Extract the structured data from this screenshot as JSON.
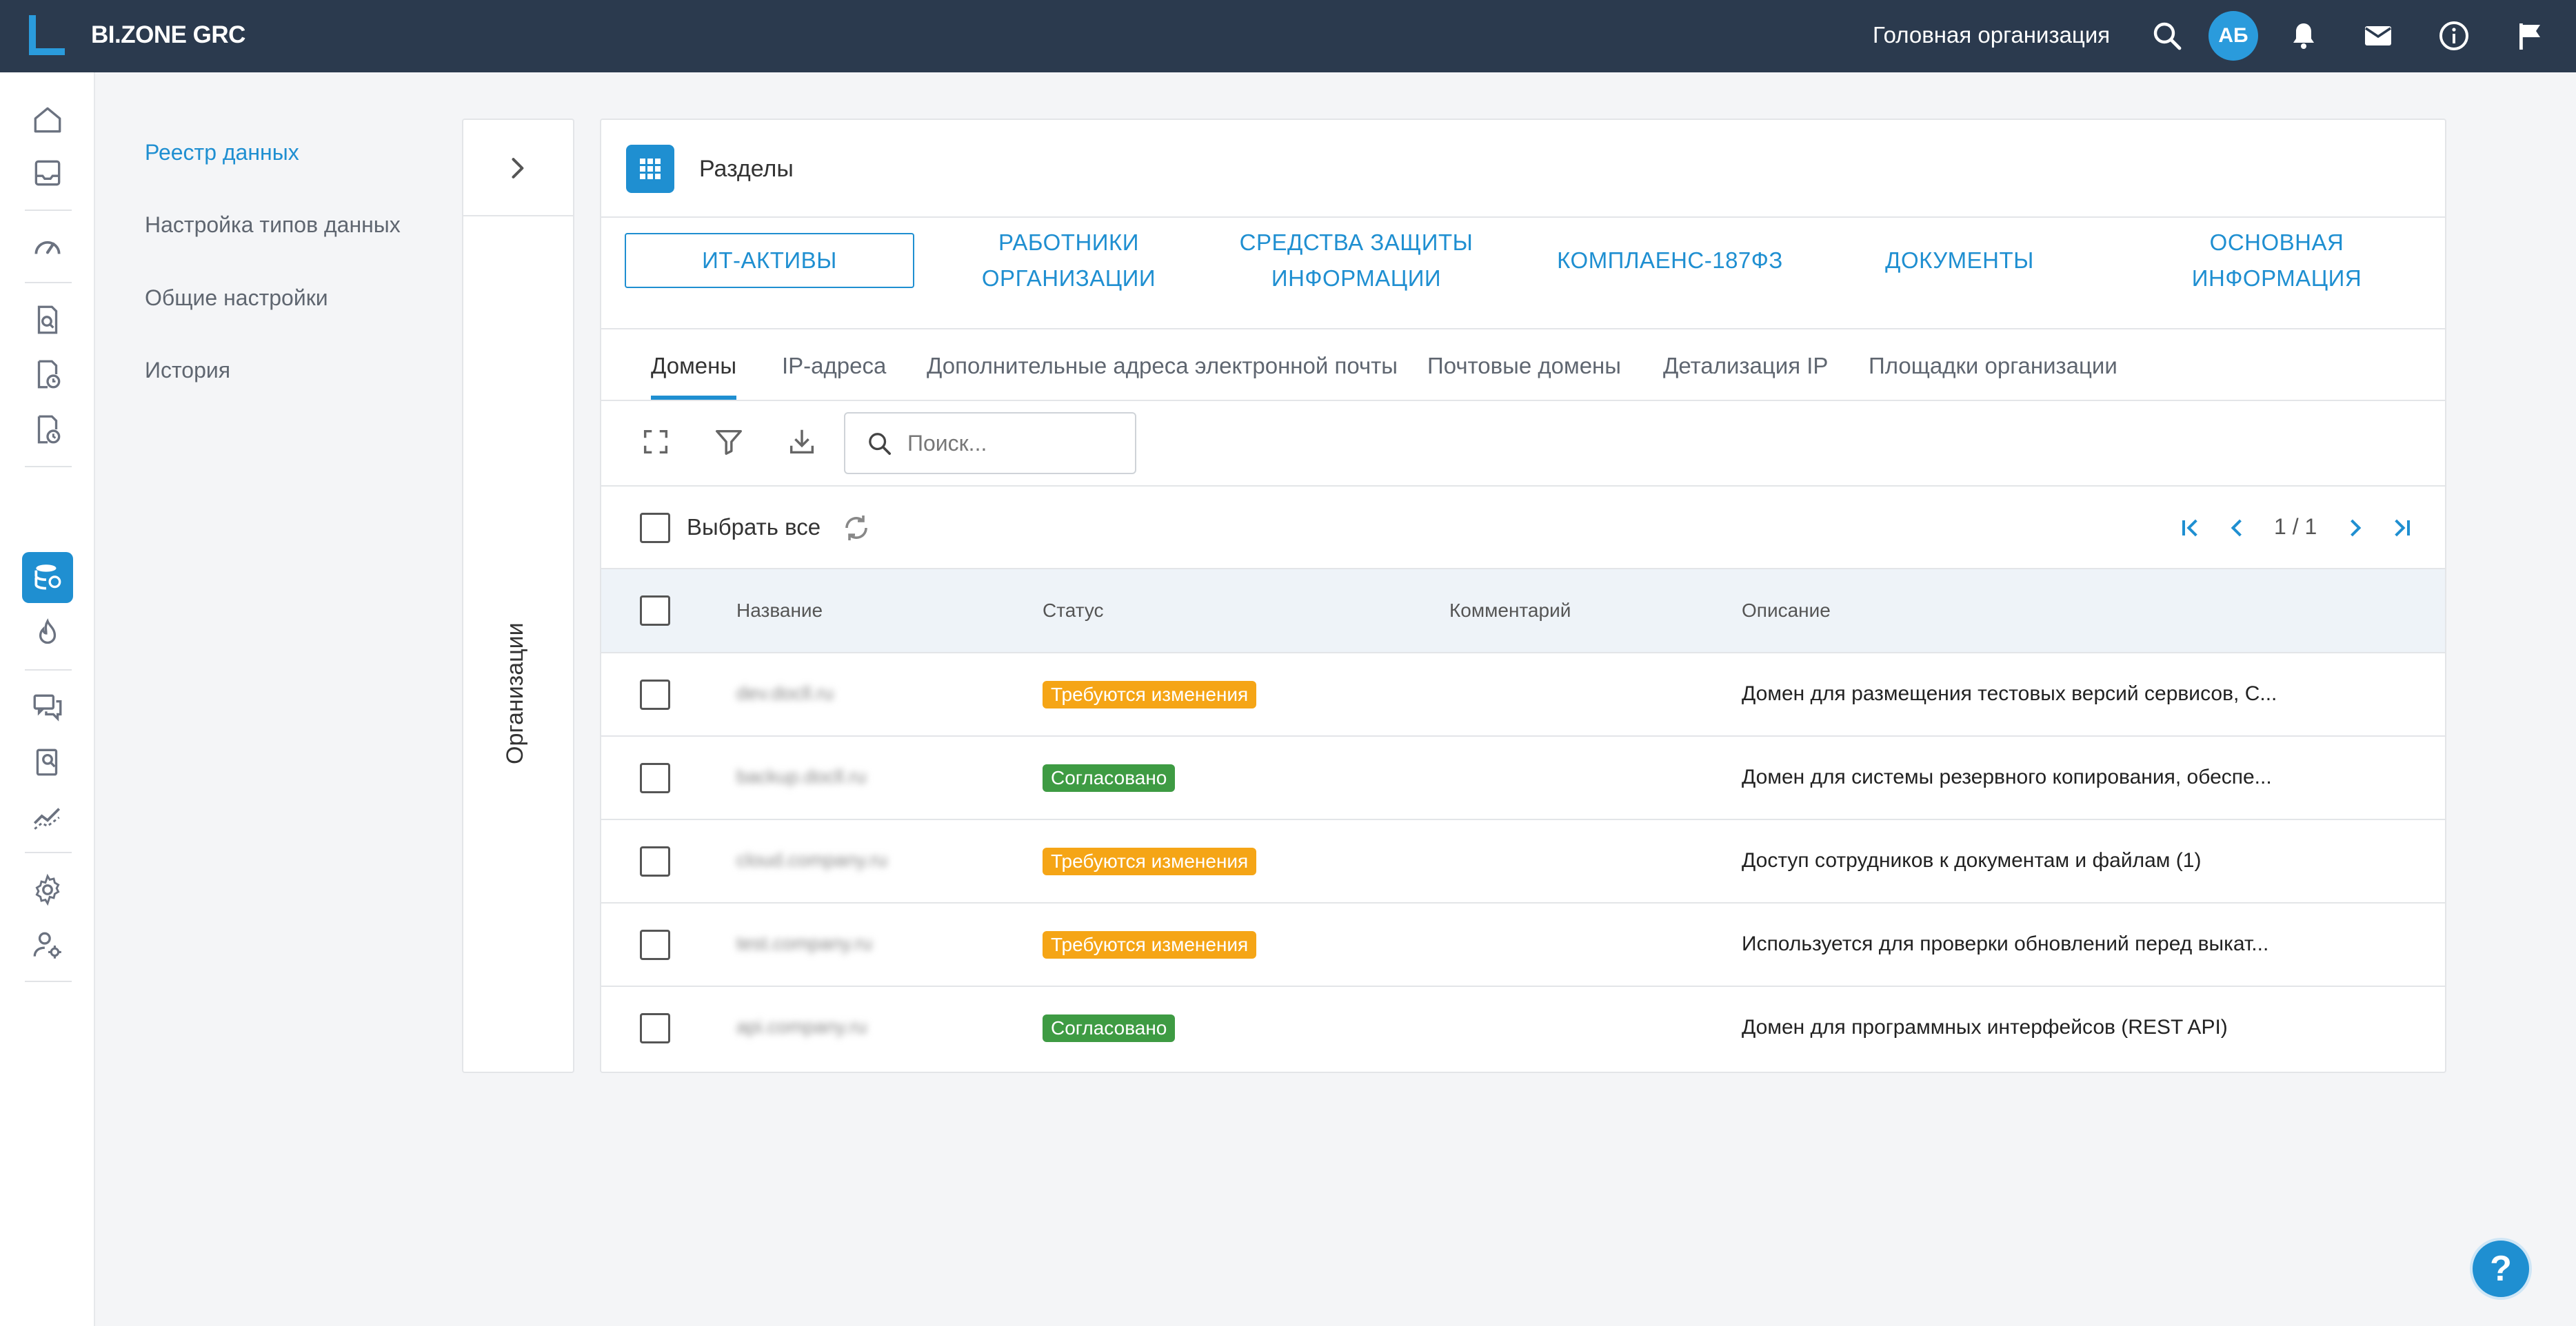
{
  "header": {
    "brand": "BI.ZONE GRC",
    "organization": "Головная организация",
    "avatar_initials": "АБ"
  },
  "leftnav": {
    "items": [
      {
        "label": "Реестр данных",
        "active": true
      },
      {
        "label": "Настройка типов данных",
        "active": false
      },
      {
        "label": "Общие настройки",
        "active": false
      },
      {
        "label": "История",
        "active": false
      }
    ]
  },
  "orgpanel": {
    "label": "Организации"
  },
  "card": {
    "title": "Разделы",
    "sections": [
      {
        "label": "ИТ-АКТИВЫ",
        "active": true
      },
      {
        "label": "РАБОТНИКИ ОРГАНИЗАЦИИ",
        "active": false
      },
      {
        "label": "СРЕДСТВА ЗАЩИТЫ ИНФОРМАЦИИ",
        "active": false
      },
      {
        "label": "КОМПЛАЕНС-187ФЗ",
        "active": false
      },
      {
        "label": "ДОКУМЕНТЫ",
        "active": false
      },
      {
        "label": "ОСНОВНАЯ ИНФОРМАЦИЯ",
        "active": false
      }
    ],
    "subtabs": [
      {
        "label": "Домены",
        "active": true
      },
      {
        "label": "IP-адреса",
        "active": false
      },
      {
        "label": "Дополнительные адреса электронной почты",
        "active": false
      },
      {
        "label": "Почтовые домены",
        "active": false
      },
      {
        "label": "Детализация IP",
        "active": false
      },
      {
        "label": "Площадки организации",
        "active": false
      }
    ],
    "search": {
      "placeholder": "Поиск...",
      "value": ""
    },
    "select_all_label": "Выбрать все",
    "pager": {
      "text": "1 / 1"
    },
    "table": {
      "columns": [
        "Название",
        "Статус",
        "Комментарий",
        "Описание"
      ],
      "rows": [
        {
          "name": "dev.docll.ru",
          "status": "Требуются изменения",
          "status_type": "warning",
          "comment": "",
          "description": "Домен для размещения тестовых версий сервисов, С..."
        },
        {
          "name": "backup.docll.ru",
          "status": "Согласовано",
          "status_type": "success",
          "comment": "",
          "description": "Домен для системы резервного копирования, обеспе..."
        },
        {
          "name": "cloud.company.ru",
          "status": "Требуются изменения",
          "status_type": "warning",
          "comment": "",
          "description": "Доступ сотрудников к документам и файлам (1)"
        },
        {
          "name": "test.company.ru",
          "status": "Требуются изменения",
          "status_type": "warning",
          "comment": "",
          "description": "Используется для проверки обновлений перед выкат..."
        },
        {
          "name": "api.company.ru",
          "status": "Согласовано",
          "status_type": "success",
          "comment": "",
          "description": "Домен для программных интерфейсов (REST API)"
        }
      ]
    }
  },
  "colors": {
    "topbar": "#2b3a4e",
    "accent": "#1f8fd1",
    "warning": "#f5a516",
    "success": "#3e9b43"
  },
  "help_label": "?"
}
